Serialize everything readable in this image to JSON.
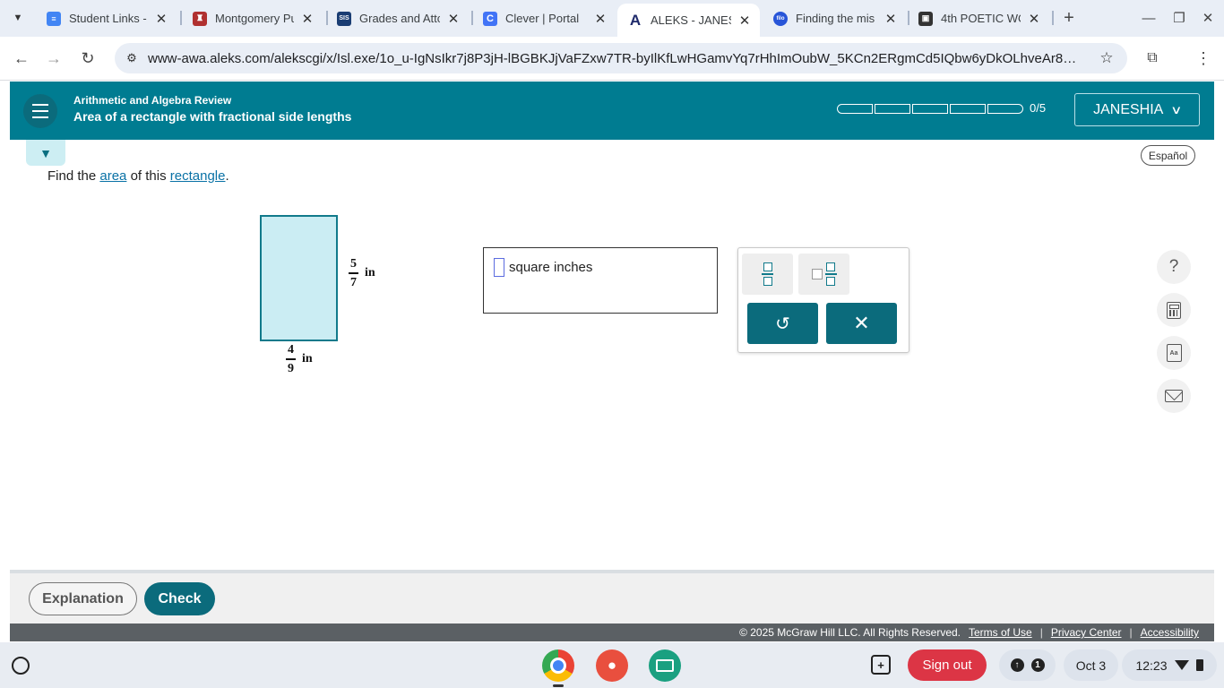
{
  "browser": {
    "tabs": [
      {
        "title": "Student Links - (",
        "favicon": "docs-icon",
        "favicon_color": "#4285f4",
        "active": false
      },
      {
        "title": "Montgomery Pu",
        "favicon": "school-crest-icon",
        "favicon_color": "#b03030",
        "active": false
      },
      {
        "title": "Grades and Attc",
        "favicon": "sis-icon",
        "favicon_text": "SIS",
        "favicon_color": "#1a3d73",
        "active": false
      },
      {
        "title": "Clever | Portal",
        "favicon": "clever-icon",
        "favicon_text": "C",
        "favicon_color": "#4274f6",
        "active": false
      },
      {
        "title": "ALEKS - JANES",
        "favicon": "aleks-icon",
        "favicon_text": "A",
        "favicon_color": "#1f2a6b",
        "active": true
      },
      {
        "title": "Finding the mis",
        "favicon": "filo-icon",
        "favicon_text": "filo",
        "favicon_color": "#2855d8",
        "active": false
      },
      {
        "title": "4th POETIC WO",
        "favicon": "portrait-icon",
        "favicon_color": "#333333",
        "active": false
      }
    ],
    "url": "www-awa.aleks.com/alekscgi/x/Isl.exe/1o_u-IgNsIkr7j8P3jH-lBGBKJjVaFZxw7TR-byIlKfLwHGamvYq7rHhImOubW_5KCn2ERgmCd5IQbw6yDkOLhveAr89jG2T..."
  },
  "header": {
    "category": "Arithmetic and Algebra Review",
    "topic": "Area of a rectangle with fractional side lengths",
    "progress": {
      "completed": 0,
      "total": 5,
      "label": "0/5"
    },
    "user_name": "JANESHIA"
  },
  "question": {
    "prefix": "Find the ",
    "link_area": "area",
    "middle": " of this ",
    "link_rectangle": "rectangle",
    "suffix": ".",
    "espanol_label": "Español"
  },
  "figure": {
    "height": {
      "numerator": "5",
      "denominator": "7",
      "unit": "in"
    },
    "width": {
      "numerator": "4",
      "denominator": "9",
      "unit": "in"
    },
    "fill_color": "#cbedf3",
    "stroke_color": "#117a8b"
  },
  "answer": {
    "value": "",
    "unit_label": "square inches"
  },
  "palette": {
    "undo_symbol": "↺",
    "clear_symbol": "✕"
  },
  "side_tools": {
    "help_symbol": "?",
    "dictionary_text": "Aa"
  },
  "actions": {
    "explanation_label": "Explanation",
    "check_label": "Check"
  },
  "footer": {
    "copyright": "© 2025 McGraw Hill LLC. All Rights Reserved.",
    "terms": "Terms of Use",
    "privacy": "Privacy Center",
    "accessibility": "Accessibility",
    "separator": "|"
  },
  "shelf": {
    "sign_out_label": "Sign out",
    "notification_count": "1",
    "date": "Oct 3",
    "time": "12:23"
  },
  "colors": {
    "aleks_teal": "#007c91",
    "button_teal": "#0b6b7c",
    "sign_out_red": "#dc3545"
  }
}
